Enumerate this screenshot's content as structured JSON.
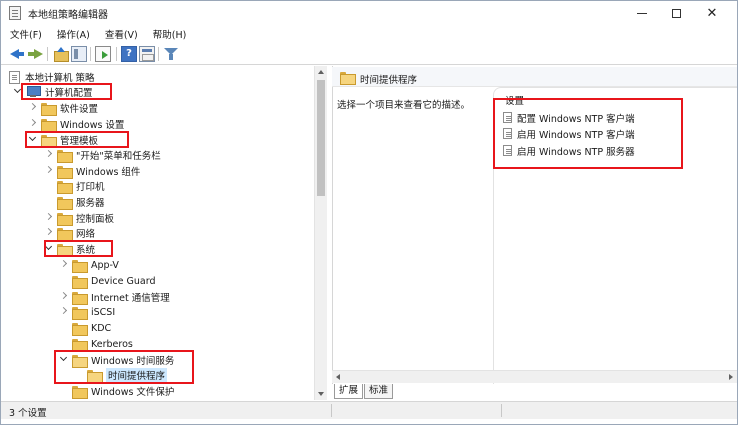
{
  "window": {
    "title": "本地组策略编辑器",
    "min_glyph": "",
    "close_glyph": "✕"
  },
  "menu": {
    "items": [
      "文件(F)",
      "操作(A)",
      "查看(V)",
      "帮助(H)"
    ]
  },
  "toolbar": {
    "help_glyph": "?"
  },
  "tree": {
    "root": "本地计算机 策略",
    "computer_config": "计算机配置",
    "software_settings": "软件设置",
    "windows_settings": "Windows 设置",
    "admin_templates": "管理模板",
    "start_menu": "\"开始\"菜单和任务栏",
    "windows_components": "Windows 组件",
    "printers": "打印机",
    "servers": "服务器",
    "control_panel": "控制面板",
    "network": "网络",
    "system": "系统",
    "app_v": "App-V",
    "device_guard": "Device Guard",
    "internet_comm": "Internet 通信管理",
    "iscsi": "iSCSI",
    "kdc": "KDC",
    "kerberos": "Kerberos",
    "w32time": "Windows 时间服务",
    "time_providers": "时间提供程序",
    "file_protection": "Windows 文件保护"
  },
  "right": {
    "header": "时间提供程序",
    "description": "选择一个项目来查看它的描述。",
    "column_header": "设置",
    "settings": [
      "配置 Windows NTP 客户端",
      "启用 Windows NTP 客户端",
      "启用 Windows NTP 服务器"
    ]
  },
  "tabs": [
    "扩展",
    "标准"
  ],
  "status": {
    "text": "3 个设置"
  },
  "colors": {
    "highlight_box": "#e8151b",
    "selection": "#cce8ff",
    "folder": "#f1c75c"
  }
}
